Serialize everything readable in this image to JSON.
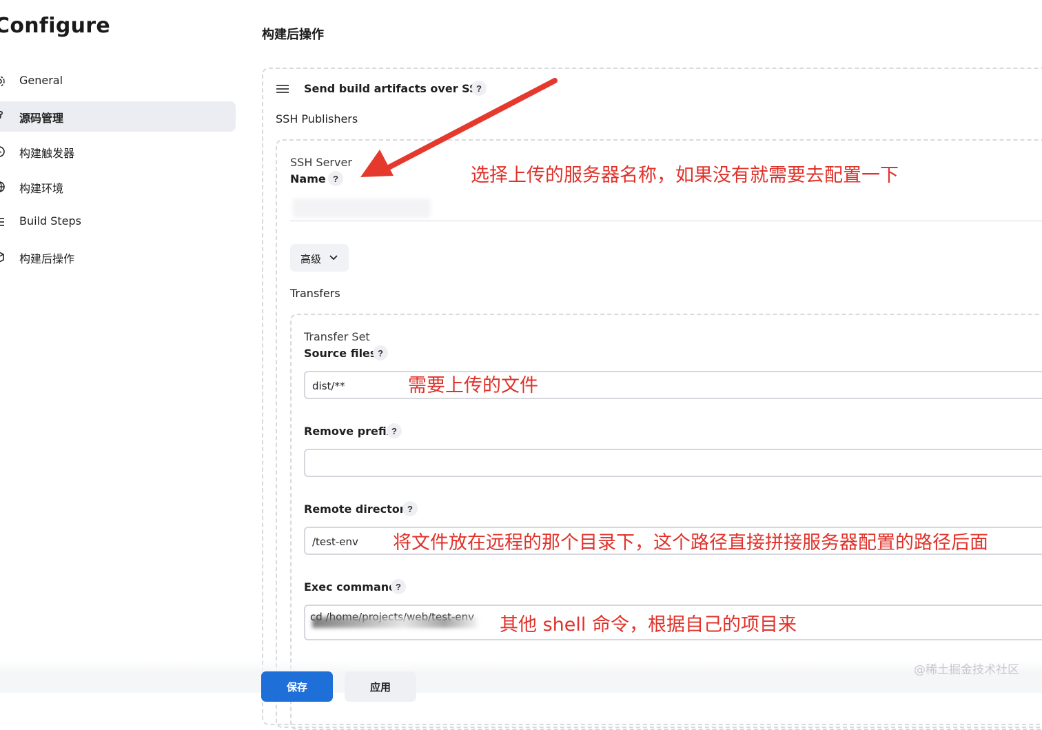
{
  "page": {
    "title": "Configure"
  },
  "sidebar": {
    "items": [
      {
        "label": "General",
        "icon": "gear-icon",
        "active": false
      },
      {
        "label": "源码管理",
        "icon": "branch-icon",
        "active": true
      },
      {
        "label": "构建触发器",
        "icon": "clock-icon",
        "active": false
      },
      {
        "label": "构建环境",
        "icon": "globe-icon",
        "active": false
      },
      {
        "label": "Build Steps",
        "icon": "list-icon",
        "active": false
      },
      {
        "label": "构建后操作",
        "icon": "cube-icon",
        "active": false
      }
    ]
  },
  "main": {
    "section_title": "构建后操作",
    "plugin": {
      "title": "Send build artifacts over SSH",
      "help": "?",
      "ssh_publishers_label": "SSH Publishers",
      "ssh_server_label": "SSH Server",
      "name_label": "Name",
      "name_help": "?",
      "advanced_label": "高级",
      "transfers_label": "Transfers",
      "transfer_set_label": "Transfer Set",
      "source_files": {
        "label": "Source files",
        "help": "?",
        "value": "dist/**"
      },
      "remove_prefix": {
        "label": "Remove prefix",
        "help": "?",
        "value": ""
      },
      "remote_directory": {
        "label": "Remote directory",
        "help": "?",
        "value": "/test-env"
      },
      "exec_command": {
        "label": "Exec command",
        "help": "?",
        "value": "cd /home/projects/web/test-env"
      }
    }
  },
  "annotations": {
    "name": "选择上传的服务器名称，如果没有就需要去配置一下",
    "source_files": "需要上传的文件",
    "remote_directory": "将文件放在远程的那个目录下，这个路径直接拼接服务器配置的路径后面",
    "exec_command": "其他 shell 命令，根据自己的项目来"
  },
  "footer": {
    "save_label": "保存",
    "apply_label": "应用"
  },
  "watermark": "@稀土掘金技术社区",
  "colors": {
    "annotation": "#e0322a",
    "primary": "#1f6fd8",
    "active_bg": "#ecedf2"
  }
}
